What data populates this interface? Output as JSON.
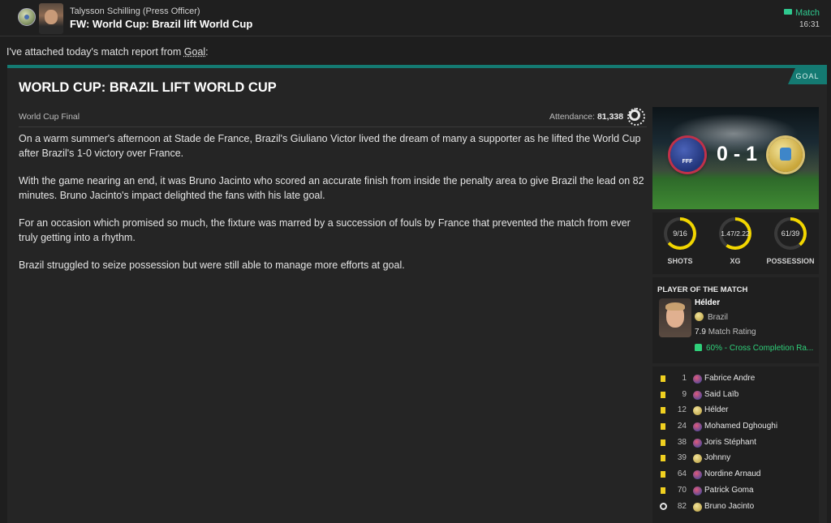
{
  "message": {
    "sender": "Talysson Schilling",
    "sender_role": "(Press Officer)",
    "subject": "FW: World Cup: Brazil lift World Cup",
    "tag": "Match",
    "time": "16:31",
    "intro_prefix": "I've attached today's match report from ",
    "intro_source": "Goal",
    "intro_suffix": ":"
  },
  "report": {
    "badge": "GOAL",
    "title": "WORLD CUP: BRAZIL LIFT WORLD CUP",
    "competition": "World Cup Final",
    "attendance_label": "Attendance:",
    "attendance_value": "81,338",
    "paragraphs": [
      "On a warm summer's afternoon at Stade de France, Brazil's Giuliano Victor lived the dream of many a supporter as he lifted the World Cup after Brazil's 1-0 victory over France.",
      "With the game nearing an end, it was Bruno Jacinto who scored an accurate finish from inside the penalty area to give Brazil the lead on 82 minutes. Bruno Jacinto's impact delighted the fans with his late goal.",
      "For an occasion which promised so much, the fixture was marred by a succession of fouls by France that prevented the match from ever truly getting into a rhythm.",
      "Brazil struggled to seize possession but were still able to manage more efforts at goal."
    ]
  },
  "score": {
    "text": "0 - 1",
    "home": "France",
    "away": "Brazil"
  },
  "stats": [
    {
      "label": "SHOTS",
      "value": "9/16",
      "away_share": 0.64
    },
    {
      "label": "XG",
      "value": "1.47/2.22",
      "away_share": 0.6
    },
    {
      "label": "POSSESSION",
      "value": "61/39",
      "away_share": 0.39
    }
  ],
  "potm": {
    "title": "PLAYER OF THE MATCH",
    "name": "Hélder",
    "nation": "Brazil",
    "rating": "7.9",
    "rating_label": "Match Rating",
    "highlight": "60% - Cross Completion Ra..."
  },
  "events": [
    {
      "type": "yellow",
      "minute": "1",
      "team": "fra",
      "player": "Fabrice Andre"
    },
    {
      "type": "yellow",
      "minute": "9",
      "team": "fra",
      "player": "Said Laïb"
    },
    {
      "type": "yellow",
      "minute": "12",
      "team": "bra",
      "player": "Hélder"
    },
    {
      "type": "yellow",
      "minute": "24",
      "team": "fra",
      "player": "Mohamed Dghoughi"
    },
    {
      "type": "yellow",
      "minute": "38",
      "team": "fra",
      "player": "Joris Stéphant"
    },
    {
      "type": "yellow",
      "minute": "39",
      "team": "bra",
      "player": "Johnny"
    },
    {
      "type": "yellow",
      "minute": "64",
      "team": "fra",
      "player": "Nordine Arnaud"
    },
    {
      "type": "yellow",
      "minute": "70",
      "team": "fra",
      "player": "Patrick Goma"
    },
    {
      "type": "goal",
      "minute": "82",
      "team": "bra",
      "player": "Bruno Jacinto"
    }
  ],
  "colors": {
    "accent": "#147a72",
    "ring": "#f2d600",
    "positive": "#2fd07a",
    "card": "#f0d020"
  }
}
